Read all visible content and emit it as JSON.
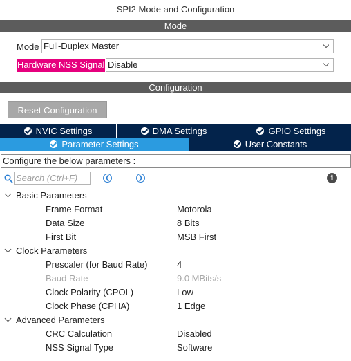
{
  "window_title": "SPI2 Mode and Configuration",
  "mode_section": {
    "title": "Mode",
    "mode_label": "Mode",
    "mode_value": "Full-Duplex Master",
    "nss_label": "Hardware NSS Signal",
    "nss_value": "Disable"
  },
  "config_section": {
    "title": "Configuration",
    "reset_button": "Reset Configuration",
    "tabs_row1": [
      "NVIC Settings",
      "DMA Settings",
      "GPIO Settings"
    ],
    "tabs_row2": [
      "Parameter Settings",
      "User Constants"
    ],
    "active_tab": "Parameter Settings",
    "instruction": "Configure the below parameters :",
    "search_placeholder": "Search (Ctrl+F)"
  },
  "groups": [
    {
      "name": "Basic Parameters",
      "params": [
        {
          "name": "Frame Format",
          "value": "Motorola"
        },
        {
          "name": "Data Size",
          "value": "8 Bits"
        },
        {
          "name": "First Bit",
          "value": "MSB First"
        }
      ]
    },
    {
      "name": "Clock Parameters",
      "params": [
        {
          "name": "Prescaler (for Baud Rate)",
          "value": "4"
        },
        {
          "name": "Baud Rate",
          "value": "9.0 MBits/s",
          "disabled": true
        },
        {
          "name": "Clock Polarity (CPOL)",
          "value": "Low"
        },
        {
          "name": "Clock Phase (CPHA)",
          "value": "1 Edge"
        }
      ]
    },
    {
      "name": "Advanced Parameters",
      "params": [
        {
          "name": "CRC Calculation",
          "value": "Disabled"
        },
        {
          "name": "NSS Signal Type",
          "value": "Software"
        }
      ]
    }
  ]
}
